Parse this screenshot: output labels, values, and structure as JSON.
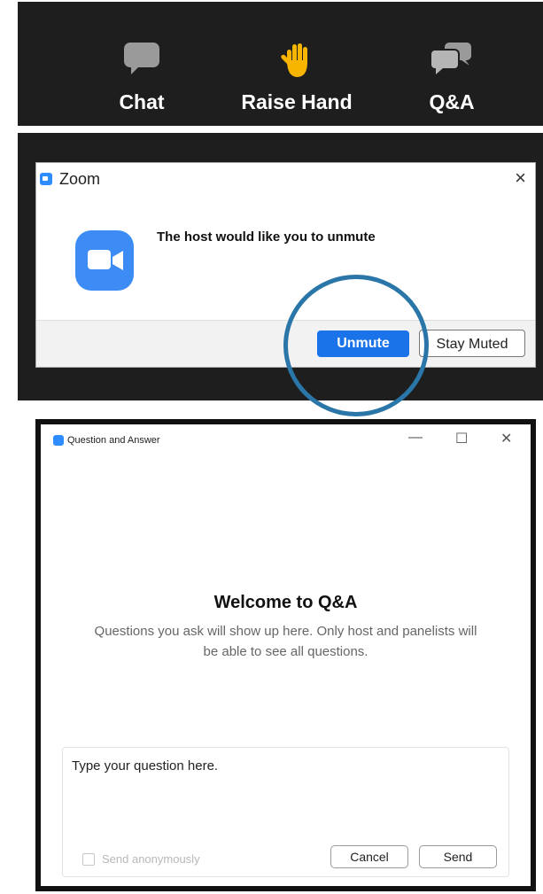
{
  "toolbar": {
    "items": [
      {
        "label": "Chat",
        "icon": "chat-bubble-icon"
      },
      {
        "label": "Raise Hand",
        "icon": "raised-hand-icon"
      },
      {
        "label": "Q&A",
        "icon": "qa-bubbles-icon"
      }
    ]
  },
  "unmute_dialog": {
    "title": "Zoom",
    "close_symbol": "×",
    "message": "The host would like you to unmute",
    "unmute_label": "Unmute",
    "stay_muted_label": "Stay Muted"
  },
  "qa_window": {
    "title": "Question and Answer",
    "minimize_symbol": "—",
    "maximize_symbol": "☐",
    "close_symbol": "✕",
    "heading": "Welcome to Q&A",
    "description": "Questions you ask will show up here. Only host and panelists will be able to see all questions.",
    "input_placeholder": "Type your question here.",
    "anonymous_label": "Send anonymously",
    "cancel_label": "Cancel",
    "send_label": "Send"
  },
  "colors": {
    "toolbar_bg": "#1e1e1e",
    "zoom_blue": "#2d8cff",
    "unmute_button": "#1a73e8",
    "highlight_circle": "#2b76a8",
    "hand_yellow": "#f7b500"
  }
}
